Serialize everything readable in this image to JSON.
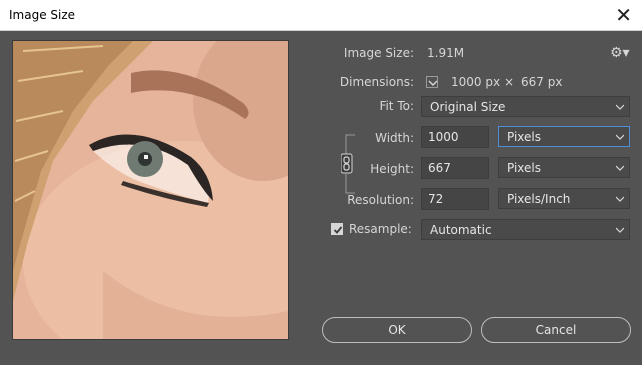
{
  "window": {
    "title": "Image Size",
    "close_glyph": "✕"
  },
  "info": {
    "image_size_label": "Image Size:",
    "image_size_value": "1.91M",
    "dimensions_label": "Dimensions:",
    "dimensions_width": "1000 px",
    "dimensions_times": "×",
    "dimensions_height": "667 px",
    "gear_icon": "gear-icon"
  },
  "fit_to": {
    "label": "Fit To:",
    "value": "Original Size"
  },
  "width": {
    "label": "Width:",
    "value": "1000",
    "unit": "Pixels"
  },
  "height": {
    "label": "Height:",
    "value": "667",
    "unit": "Pixels"
  },
  "resolution": {
    "label": "Resolution:",
    "value": "72",
    "unit": "Pixels/Inch"
  },
  "resample": {
    "label": "Resample:",
    "checked": true,
    "method": "Automatic"
  },
  "buttons": {
    "ok": "OK",
    "cancel": "Cancel"
  },
  "colors": {
    "dialog_bg": "#535353",
    "accent": "#4d8ed8",
    "text": "#d6d6d6"
  }
}
